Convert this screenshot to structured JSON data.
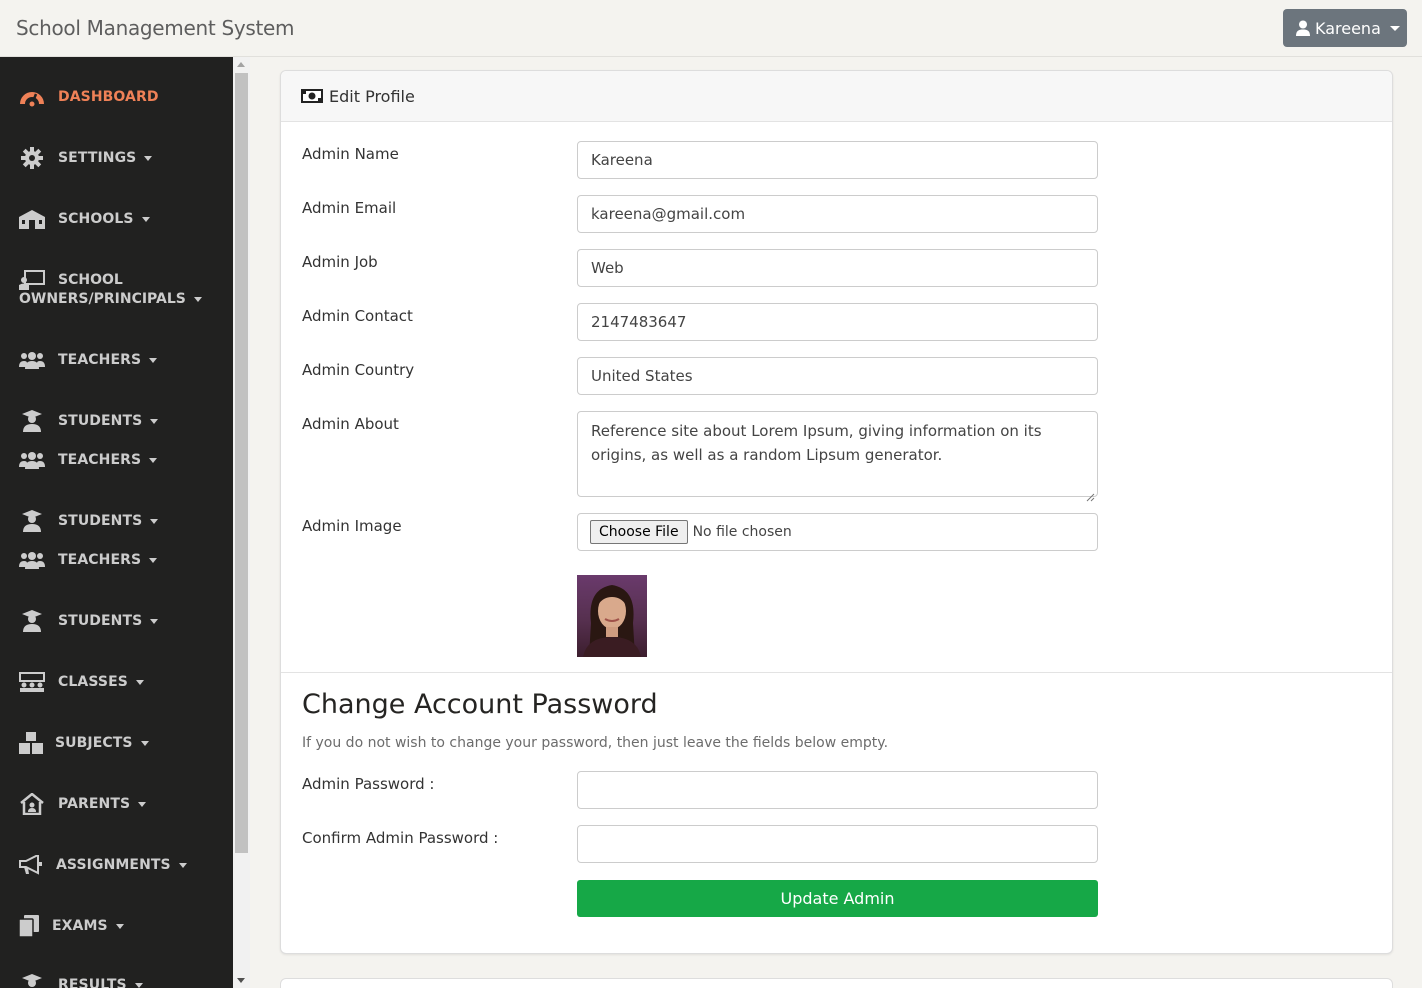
{
  "app": {
    "title": "School Management System"
  },
  "user": {
    "name": "Kareena"
  },
  "sidebar": {
    "dashboard": "DASHBOARD",
    "settings": "SETTINGS",
    "schools": "SCHOOLS",
    "owners_line1": "SCHOOL",
    "owners_line2": "OWNERS/PRINCIPALS",
    "teachers": "TEACHERS",
    "students": "STUDENTS",
    "classes": "CLASSES",
    "subjects": "SUBJECTS",
    "parents": "PARENTS",
    "assignments": "ASSIGNMENTS",
    "exams": "EXAMS",
    "results": "RESULTS"
  },
  "colors": {
    "sidebar_bg": "#212120",
    "active": "#ef8157",
    "update_btn": "#16a847",
    "user_btn": "#6c757d"
  },
  "card": {
    "title": "Edit Profile"
  },
  "form": {
    "name_label": "Admin Name",
    "name_value": "Kareena",
    "email_label": "Admin Email",
    "email_value": "kareena@gmail.com",
    "job_label": "Admin Job",
    "job_value": "Web",
    "contact_label": "Admin Contact",
    "contact_value": "2147483647",
    "country_label": "Admin Country",
    "country_value": "United States",
    "about_label": "Admin About",
    "about_value": "Reference site about Lorem Ipsum, giving information on its origins, as well as a random Lipsum generator.",
    "image_label": "Admin Image",
    "file_button": "Choose File",
    "file_status": "No file chosen"
  },
  "password": {
    "title": "Change Account Password",
    "note": "If you do not wish to change your password, then just leave the fields below empty.",
    "password_label": "Admin Password :",
    "confirm_label": "Confirm Admin Password :",
    "password_value": "",
    "confirm_value": ""
  },
  "actions": {
    "update_label": "Update Admin"
  }
}
